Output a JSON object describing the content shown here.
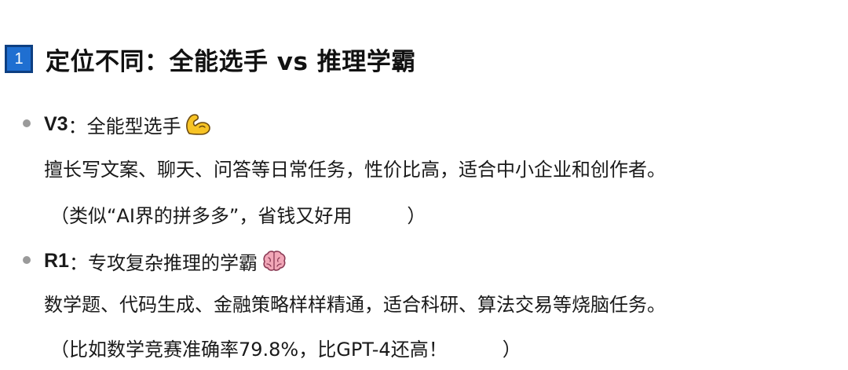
{
  "section": {
    "number": "1",
    "title": "定位不同：全能选手 vs 推理学霸"
  },
  "items": [
    {
      "key": "V3",
      "separator": "：",
      "title": "全能型选手",
      "emoji": "flexed-biceps-icon",
      "description": "擅长写文案、聊天、问答等日常任务，性价比高，适合中小企业和创作者。",
      "note_open": "（类似“AI界的拼多多”，省钱又好用",
      "note_close": "）"
    },
    {
      "key": "R1",
      "separator": "：",
      "title": "专攻复杂推理的学霸",
      "emoji": "brain-icon",
      "description": "数学题、代码生成、金融策略样样精通，适合科研、算法交易等烧脑任务。",
      "note_open": "（比如数学竞赛准确率79.8%，比GPT-4还高！",
      "note_close": "）"
    }
  ],
  "colors": {
    "badge": "#1f6fd1",
    "badge_border": "#0d3f82",
    "bullet": "#9a9a9a",
    "biceps": "#f7c325",
    "brain": "#f2a7b8"
  }
}
